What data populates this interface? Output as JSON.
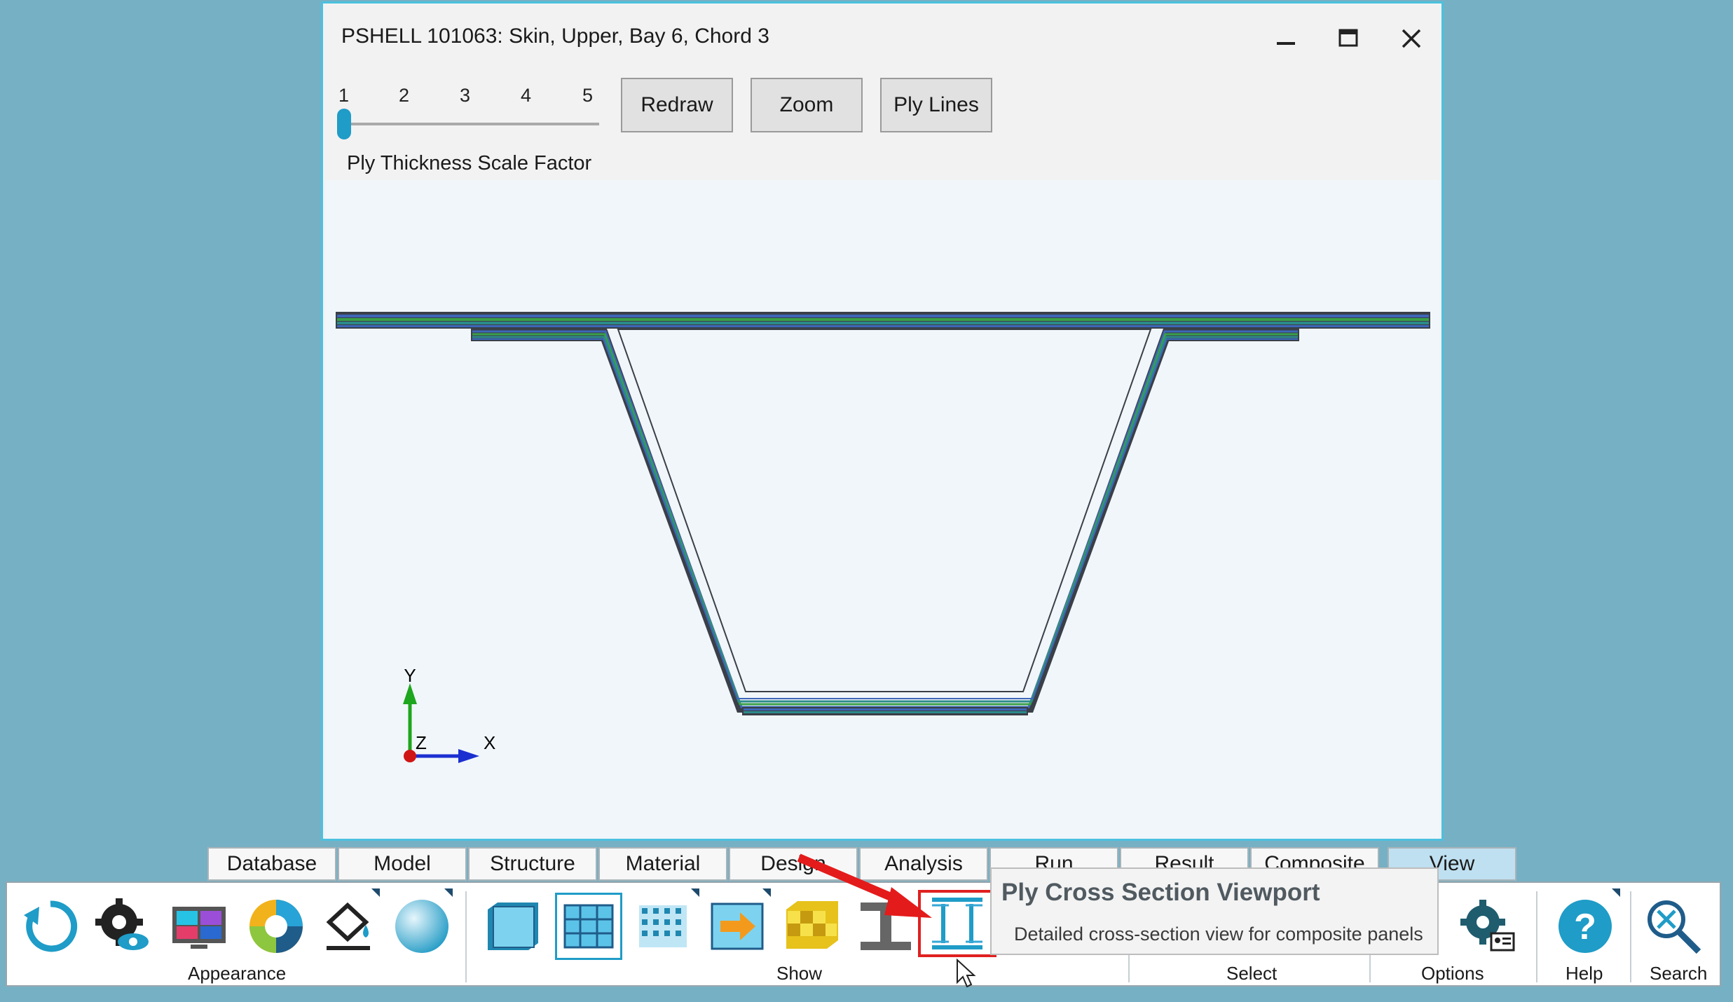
{
  "window": {
    "title": "PSHELL 101063: Skin, Upper, Bay 6, Chord 3",
    "slider": {
      "ticks": [
        "1",
        "2",
        "3",
        "4",
        "5"
      ],
      "value": 1
    },
    "buttons": {
      "redraw": "Redraw",
      "zoom": "Zoom",
      "ply_lines": "Ply Lines"
    },
    "scale_label": "Ply Thickness Scale Factor",
    "axes": {
      "y": "Y",
      "z": "Z",
      "x": "X"
    }
  },
  "ribbon": {
    "tabs": [
      "Database",
      "Model",
      "Structure",
      "Material",
      "Design",
      "Analysis",
      "Run",
      "Result",
      "Composite",
      "View"
    ],
    "active_tab": "View",
    "groups": {
      "appearance": "Appearance",
      "show": "Show",
      "select": "Select",
      "options": "Options",
      "help": "Help",
      "search": "Search"
    }
  },
  "tooltip": {
    "title": "Ply Cross Section Viewport",
    "description": "Detailed cross-section view for composite panels"
  },
  "colors": {
    "accent": "#1f9cc7",
    "window_border": "#4cc1df",
    "highlight": "#e02020",
    "arrow": "#e41b1b",
    "ply_blue": "#3d66b8",
    "ply_green": "#3aa04a",
    "ply_teal": "#2c8a8a"
  },
  "icons": [
    "refresh-icon",
    "display-settings-gear-icon",
    "viewport-layout-icon",
    "color-wheel-icon",
    "fill-bucket-icon",
    "sphere-icon",
    "panel-icon",
    "mesh-panel-icon",
    "dotted-panel-icon",
    "arrow-panel-icon",
    "checker-panel-icon",
    "i-beam-icon",
    "ply-cross-section-icon",
    "options-gear-icon",
    "help-icon",
    "search-icon"
  ]
}
